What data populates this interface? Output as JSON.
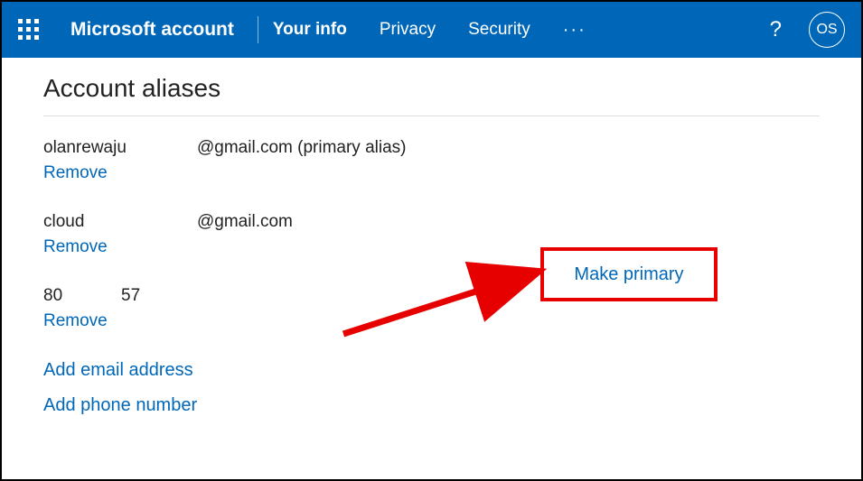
{
  "header": {
    "brand": "Microsoft account",
    "nav": {
      "your_info": "Your info",
      "privacy": "Privacy",
      "security": "Security"
    },
    "more": "···",
    "help": "?",
    "avatar_initials": "OS"
  },
  "page": {
    "title": "Account aliases"
  },
  "aliases": [
    {
      "name": "olanrewaju",
      "domain": "@gmail.com (primary alias)",
      "remove": "Remove"
    },
    {
      "name": "cloud",
      "domain": "@gmail.com",
      "remove": "Remove",
      "make_primary": "Make primary"
    }
  ],
  "phone": {
    "a": "80",
    "b": "57",
    "remove": "Remove"
  },
  "actions": {
    "add_email": "Add email address",
    "add_phone": "Add phone number"
  },
  "colors": {
    "brand": "#0067b8",
    "highlight": "#e60000"
  }
}
